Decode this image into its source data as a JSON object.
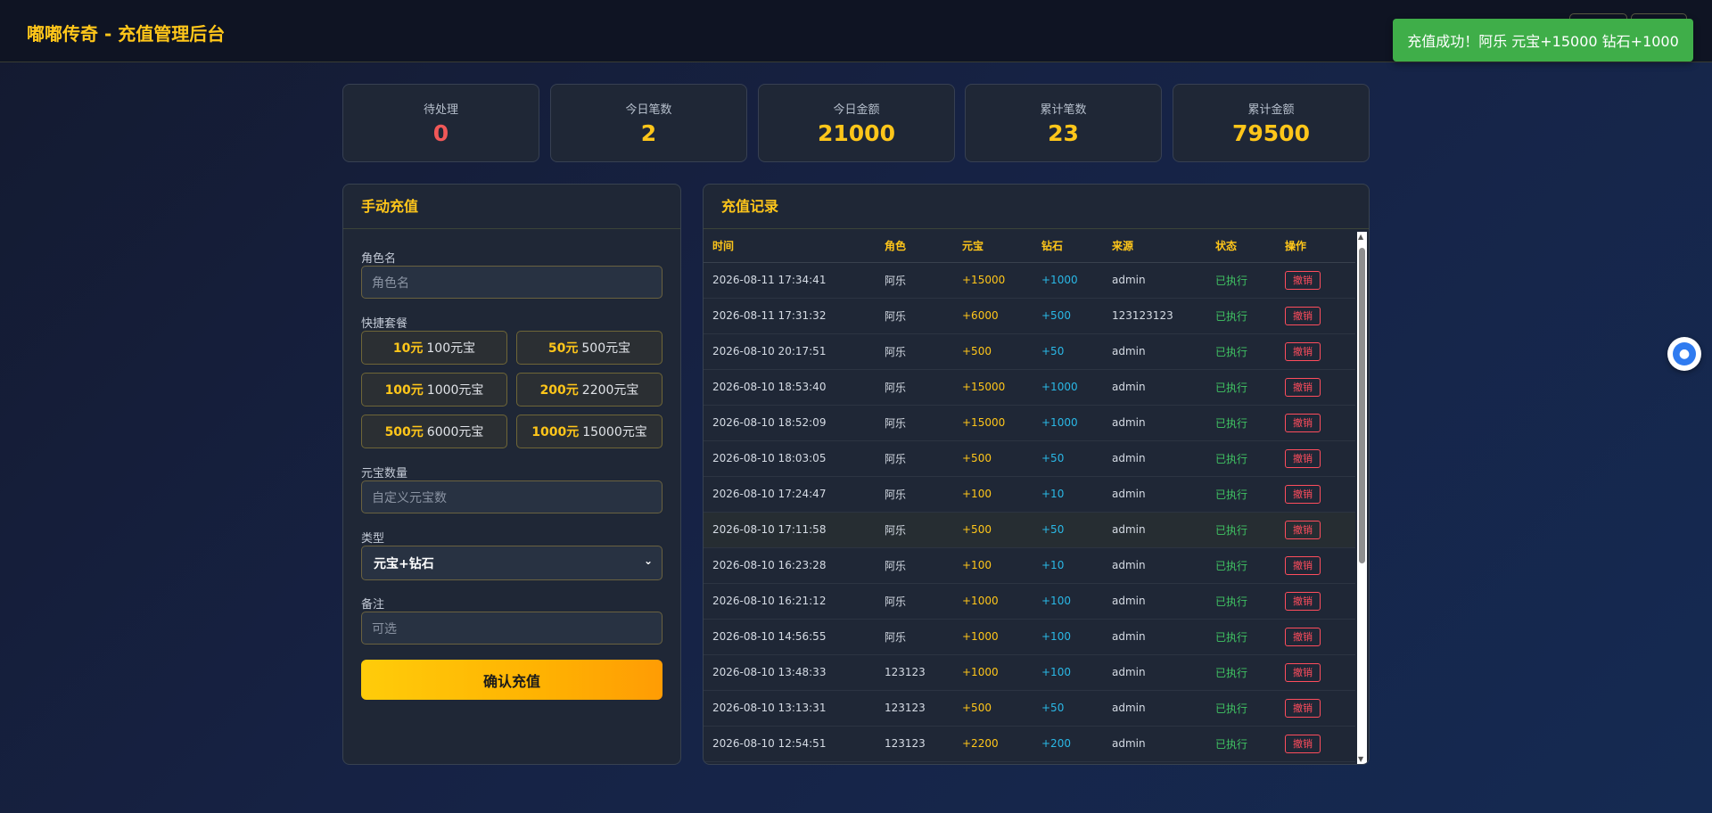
{
  "header": {
    "title": "嘟嘟传奇 - 充值管理后台"
  },
  "toast": {
    "message": "充值成功！阿乐 元宝+15000 钻石+1000"
  },
  "stats": [
    {
      "label": "待处理",
      "value": "0"
    },
    {
      "label": "今日笔数",
      "value": "2"
    },
    {
      "label": "今日金额",
      "value": "21000"
    },
    {
      "label": "累计笔数",
      "value": "23"
    },
    {
      "label": "累计金额",
      "value": "79500"
    }
  ],
  "manual": {
    "title": "手动充值",
    "role_label": "角色名",
    "role_placeholder": "角色名",
    "packages_label": "快捷套餐",
    "packages": [
      {
        "price": "10元",
        "amount": "100元宝"
      },
      {
        "price": "50元",
        "amount": "500元宝"
      },
      {
        "price": "100元",
        "amount": "1000元宝"
      },
      {
        "price": "200元",
        "amount": "2200元宝"
      },
      {
        "price": "500元",
        "amount": "6000元宝"
      },
      {
        "price": "1000元",
        "amount": "15000元宝"
      }
    ],
    "yuanbao_label": "元宝数量",
    "yuanbao_placeholder": "自定义元宝数",
    "type_label": "类型",
    "type_value": "元宝+钻石",
    "note_label": "备注",
    "note_placeholder": "可选",
    "submit_label": "确认充值"
  },
  "records": {
    "title": "充值记录",
    "columns": [
      "时间",
      "角色",
      "元宝",
      "钻石",
      "来源",
      "状态",
      "操作"
    ],
    "action_label": "撤销",
    "rows": [
      {
        "time": "2026-08-11 17:34:41",
        "role": "阿乐",
        "yuanbao": "+15000",
        "diamond": "+1000",
        "source": "admin",
        "status": "已执行"
      },
      {
        "time": "2026-08-11 17:31:32",
        "role": "阿乐",
        "yuanbao": "+6000",
        "diamond": "+500",
        "source": "123123123",
        "status": "已执行"
      },
      {
        "time": "2026-08-10 20:17:51",
        "role": "阿乐",
        "yuanbao": "+500",
        "diamond": "+50",
        "source": "admin",
        "status": "已执行"
      },
      {
        "time": "2026-08-10 18:53:40",
        "role": "阿乐",
        "yuanbao": "+15000",
        "diamond": "+1000",
        "source": "admin",
        "status": "已执行"
      },
      {
        "time": "2026-08-10 18:52:09",
        "role": "阿乐",
        "yuanbao": "+15000",
        "diamond": "+1000",
        "source": "admin",
        "status": "已执行"
      },
      {
        "time": "2026-08-10 18:03:05",
        "role": "阿乐",
        "yuanbao": "+500",
        "diamond": "+50",
        "source": "admin",
        "status": "已执行"
      },
      {
        "time": "2026-08-10 17:24:47",
        "role": "阿乐",
        "yuanbao": "+100",
        "diamond": "+10",
        "source": "admin",
        "status": "已执行"
      },
      {
        "time": "2026-08-10 17:11:58",
        "role": "阿乐",
        "yuanbao": "+500",
        "diamond": "+50",
        "source": "admin",
        "status": "已执行"
      },
      {
        "time": "2026-08-10 16:23:28",
        "role": "阿乐",
        "yuanbao": "+100",
        "diamond": "+10",
        "source": "admin",
        "status": "已执行"
      },
      {
        "time": "2026-08-10 16:21:12",
        "role": "阿乐",
        "yuanbao": "+1000",
        "diamond": "+100",
        "source": "admin",
        "status": "已执行"
      },
      {
        "time": "2026-08-10 14:56:55",
        "role": "阿乐",
        "yuanbao": "+1000",
        "diamond": "+100",
        "source": "admin",
        "status": "已执行"
      },
      {
        "time": "2026-08-10 13:48:33",
        "role": "123123",
        "yuanbao": "+1000",
        "diamond": "+100",
        "source": "admin",
        "status": "已执行"
      },
      {
        "time": "2026-08-10 13:13:31",
        "role": "123123",
        "yuanbao": "+500",
        "diamond": "+50",
        "source": "admin",
        "status": "已执行"
      },
      {
        "time": "2026-08-10 12:54:51",
        "role": "123123",
        "yuanbao": "+2200",
        "diamond": "+200",
        "source": "admin",
        "status": "已执行"
      }
    ]
  },
  "icons": {
    "scroll_up": "scroll-up-arrow",
    "scroll_down": "scroll-down-arrow",
    "select": "chevron-down-icon",
    "assistant": "chat-bubble-icon"
  },
  "colors": {
    "accent": "#ffc61a",
    "success": "#40c463",
    "danger": "#ff4d5d",
    "diamond": "#2ab8e6",
    "toast_bg": "#3fae49"
  }
}
